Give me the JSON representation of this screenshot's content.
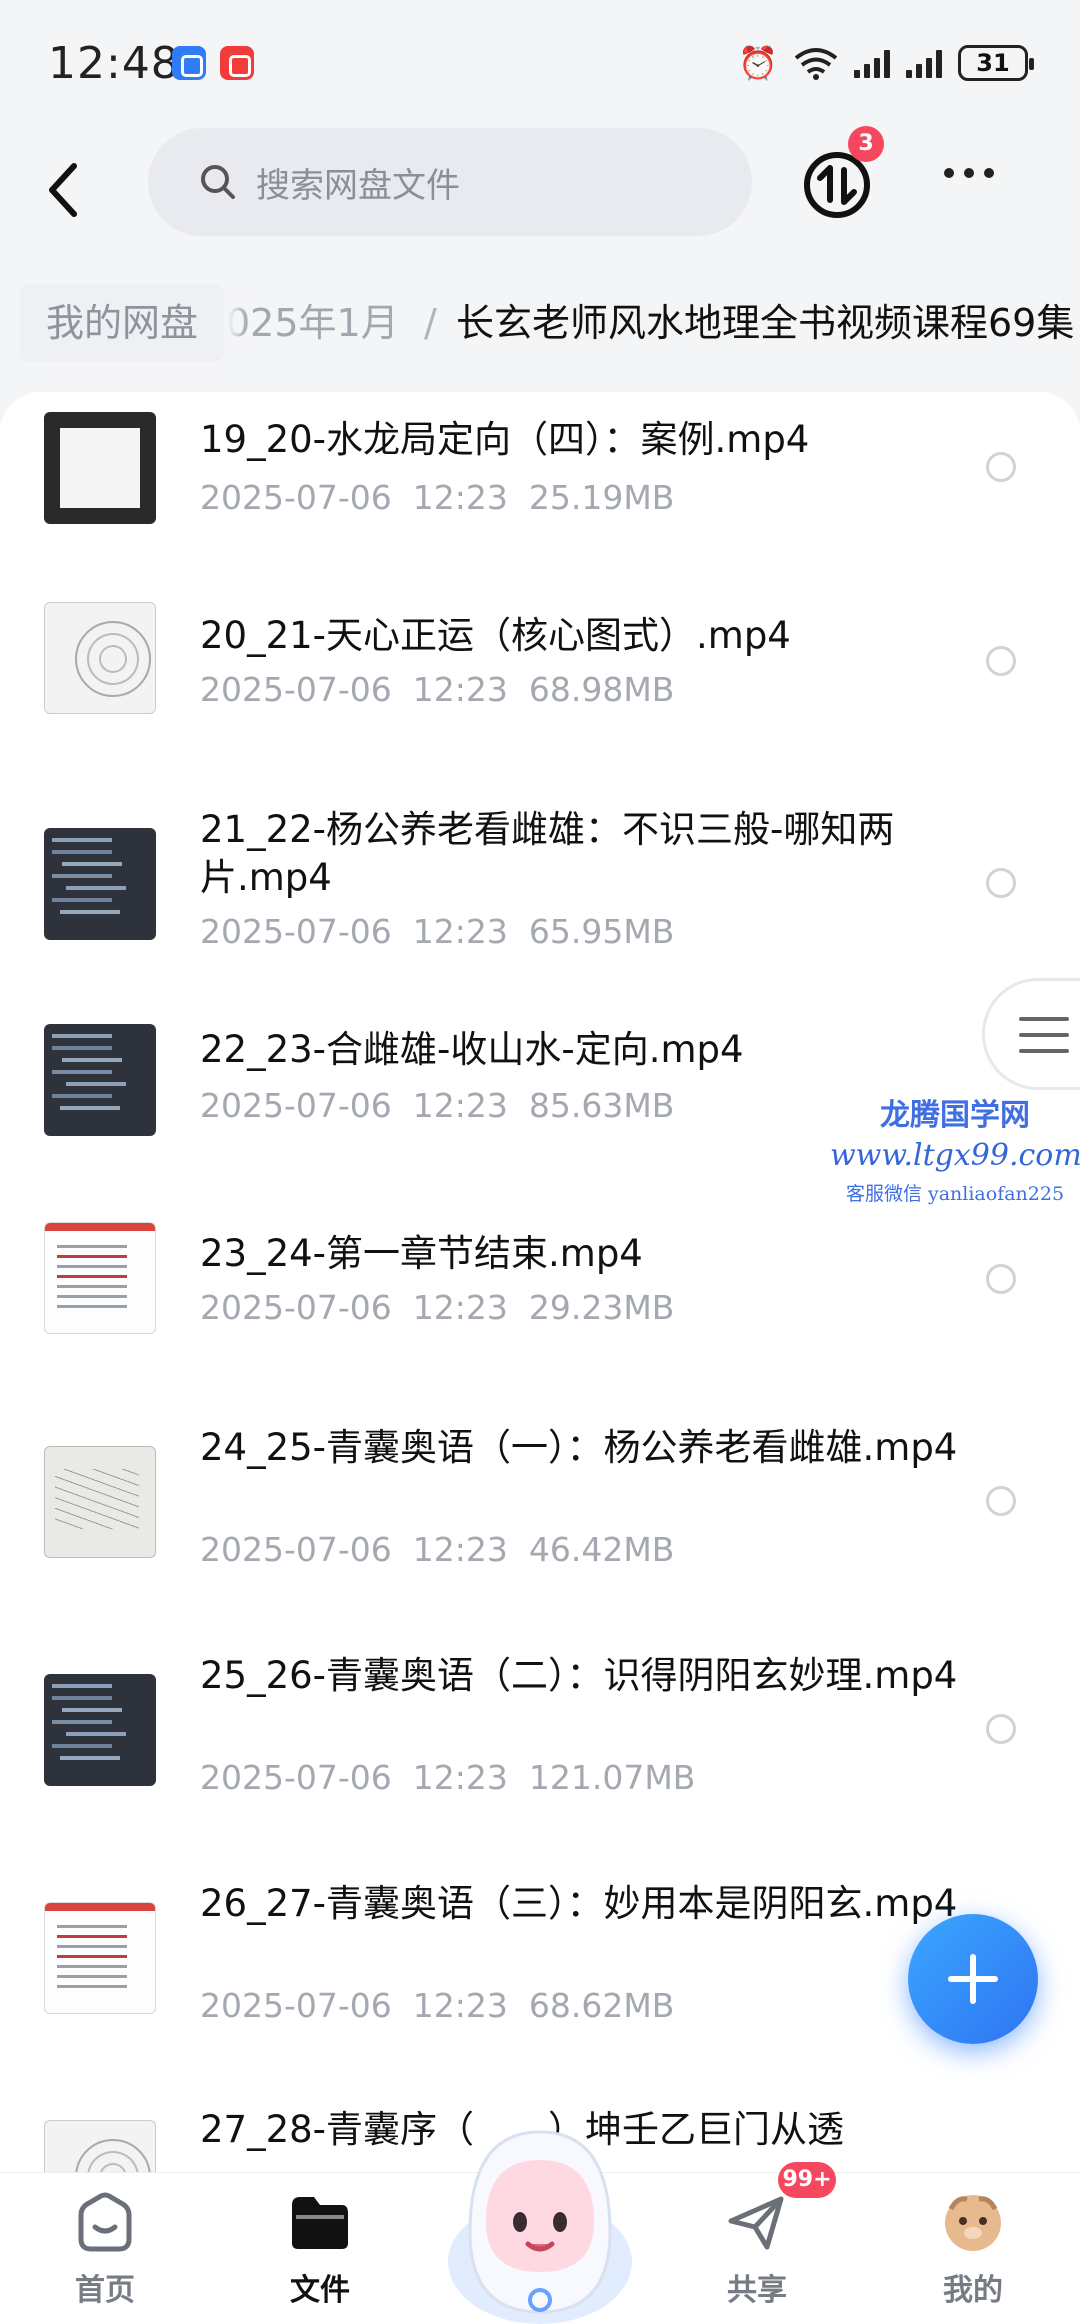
{
  "status_bar": {
    "time": "12:48",
    "battery": "31"
  },
  "top_bar": {
    "search_placeholder": "搜索网盘文件",
    "transfer_badge": "3"
  },
  "breadcrumb": {
    "root": "我的网盘",
    "middle": "025年1月",
    "separator": "/",
    "current": "长玄老师风水地理全书视频课程69集"
  },
  "files": [
    {
      "title": "19_20-水龙局定向（四）：案例.mp4",
      "date": "2025-07-06",
      "time": "12:23",
      "size": "25.19MB",
      "thumb": "frame"
    },
    {
      "title": "20_21-天心正运（核心图式）.mp4",
      "date": "2025-07-06",
      "time": "12:23",
      "size": "68.98MB",
      "thumb": "chart"
    },
    {
      "title": "21_22-杨公养老看雌雄：不识三般-哪知两片.mp4",
      "date": "2025-07-06",
      "time": "12:23",
      "size": "65.95MB",
      "thumb": "dark"
    },
    {
      "title": "22_23-合雌雄-收山水-定向.mp4",
      "date": "2025-07-06",
      "time": "12:23",
      "size": "85.63MB",
      "thumb": "dark"
    },
    {
      "title": "23_24-第一章节结束.mp4",
      "date": "2025-07-06",
      "time": "12:23",
      "size": "29.23MB",
      "thumb": "doc"
    },
    {
      "title": "24_25-青囊奥语（一）：杨公养老看雌雄.mp4",
      "date": "2025-07-06",
      "time": "12:23",
      "size": "46.42MB",
      "thumb": "board"
    },
    {
      "title": "25_26-青囊奥语（二）：识得阴阳玄妙理.mp4",
      "date": "2025-07-06",
      "time": "12:23",
      "size": "121.07MB",
      "thumb": "dark"
    },
    {
      "title": "26_27-青囊奥语（三）：妙用本是阴阳玄.mp4",
      "date": "2025-07-06",
      "time": "12:23",
      "size": "68.62MB",
      "thumb": "doc"
    },
    {
      "title": "27_28-青囊序（　　）坤壬乙巨门从透",
      "date": "",
      "time": "",
      "size": "",
      "thumb": "chart"
    }
  ],
  "watermark": {
    "line1": "龙腾国学网",
    "line2": "www.ltgx99.com",
    "line3": "客服微信 yanliaofan225"
  },
  "bottom_nav": {
    "home": "首页",
    "files": "文件",
    "share": "共享",
    "share_badge": "99+",
    "me": "我的"
  },
  "colors": {
    "accent": "#2f74f2",
    "badge": "#f5475e"
  }
}
